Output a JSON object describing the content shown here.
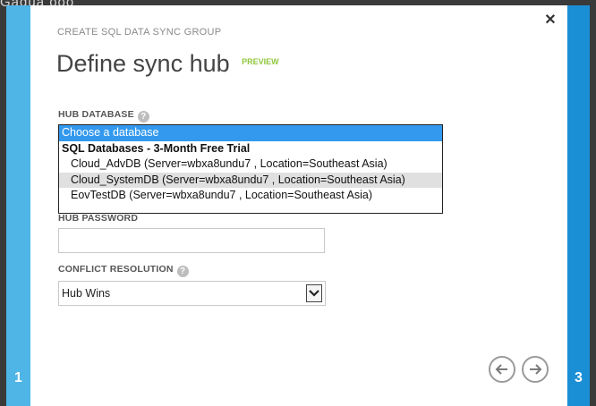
{
  "background": {
    "partial_text": "Gadua ooo"
  },
  "wizard": {
    "caption": "CREATE SQL DATA SYNC GROUP",
    "title": "Define sync hub",
    "badge": "PREVIEW",
    "close_icon": "close-icon",
    "steps": {
      "left": "1",
      "right": "3"
    }
  },
  "hub_database": {
    "label": "HUB DATABASE",
    "help_icon": "?",
    "options": [
      "Choose a database",
      "SQL Databases - 3-Month Free Trial",
      "Cloud_AdvDB (Server=wbxa8undu7 , Location=Southeast Asia)",
      "Cloud_SystemDB (Server=wbxa8undu7 , Location=Southeast Asia)",
      "EovTestDB (Server=wbxa8undu7 , Location=Southeast Asia)"
    ]
  },
  "hub_password": {
    "label": "HUB PASSWORD",
    "value": ""
  },
  "conflict_resolution": {
    "label": "CONFLICT RESOLUTION",
    "help_icon": "?",
    "value": "Hub Wins"
  },
  "navigation": {
    "back_icon": "arrow-left-icon",
    "next_icon": "arrow-right-icon"
  },
  "colors": {
    "accent": "#1b8fd6",
    "left_rail": "#4fb5e6",
    "selection": "#3399ee",
    "preview_badge": "#8fc63c"
  }
}
